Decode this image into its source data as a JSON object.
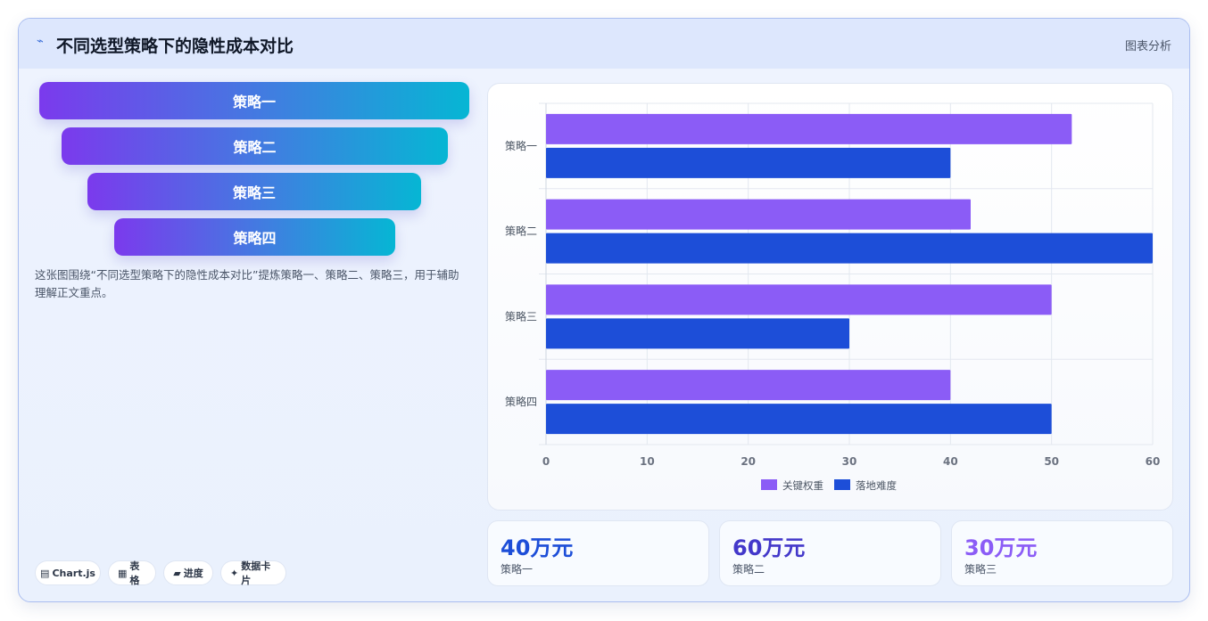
{
  "header": {
    "title": "不同选型策略下的隐性成本对比",
    "tag": "图表分析",
    "icon": "chart-line-icon"
  },
  "funnel": [
    "策略一",
    "策略二",
    "策略三",
    "策略四"
  ],
  "description": "这张图围绕“不同选型策略下的隐性成本对比”提炼策略一、策略二、策略三，用于辅助理解正文重点。",
  "chips": [
    {
      "icon": "chart-icon",
      "glyph": "▤",
      "label": "Chart.js"
    },
    {
      "icon": "table-icon",
      "glyph": "▦",
      "label": "表格"
    },
    {
      "icon": "progress-icon",
      "glyph": "▰",
      "label": "进度"
    },
    {
      "icon": "card-icon",
      "glyph": "✦",
      "label": "数据卡片"
    }
  ],
  "stats": [
    {
      "value": "40万元",
      "label": "策略一",
      "color": "#1d4ed8"
    },
    {
      "value": "60万元",
      "label": "策略二",
      "color": "#4338ca"
    },
    {
      "value": "30万元",
      "label": "策略三",
      "color": "#8b5cf6"
    }
  ],
  "chart_data": {
    "type": "bar",
    "orientation": "horizontal",
    "categories": [
      "策略一",
      "策略二",
      "策略三",
      "策略四"
    ],
    "series": [
      {
        "name": "关键权重",
        "values": [
          52,
          42,
          50,
          40
        ],
        "color": "#8b5cf6"
      },
      {
        "name": "落地难度",
        "values": [
          40,
          60,
          30,
          50
        ],
        "color": "#1d4ed8"
      }
    ],
    "xlim": [
      0,
      60
    ],
    "xticks": [
      0,
      10,
      20,
      30,
      40,
      50,
      60
    ],
    "grid": true,
    "legend": "bottom"
  }
}
